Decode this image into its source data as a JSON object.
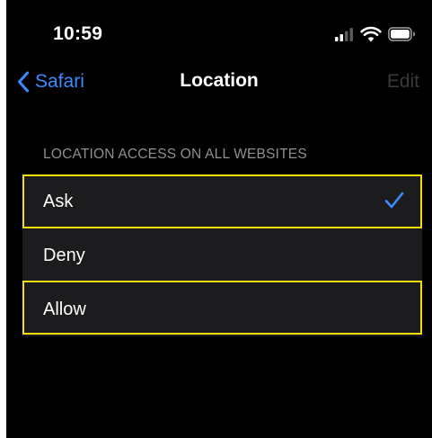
{
  "status_bar": {
    "time": "10:59"
  },
  "nav": {
    "back_label": "Safari",
    "title": "Location",
    "edit_label": "Edit"
  },
  "section": {
    "header": "LOCATION ACCESS ON ALL WEBSITES",
    "options": [
      {
        "label": "Ask",
        "selected": true,
        "highlighted": true
      },
      {
        "label": "Deny",
        "selected": false,
        "highlighted": false
      },
      {
        "label": "Allow",
        "selected": false,
        "highlighted": true
      }
    ]
  },
  "colors": {
    "background": "#000000",
    "accent": "#3a8dff",
    "cell": "#1c1c1e",
    "highlight": "#f2dd0f"
  },
  "icons": {
    "back": "chevron-left-icon",
    "check": "checkmark-icon",
    "signal": "cellular-signal-icon",
    "wifi": "wifi-icon",
    "battery": "battery-icon"
  }
}
